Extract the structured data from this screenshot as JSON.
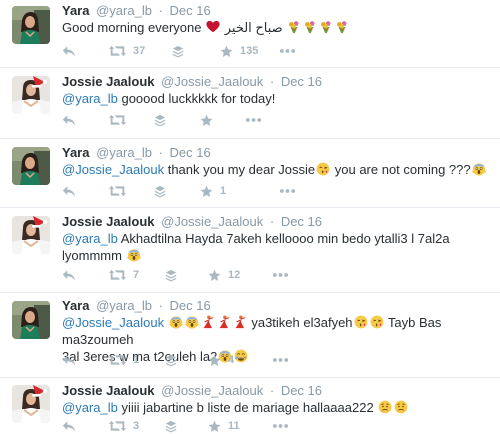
{
  "tweets": [
    {
      "fullname": "Yara",
      "username": "@yara_lb",
      "date": "Dec 16",
      "text_before": "Good morning everyone",
      "text_arabic": "صباح الخير",
      "mention": "",
      "text_after": "",
      "retweets": "37",
      "favorites": "135"
    },
    {
      "fullname": "Jossie Jaalouk",
      "username": "@Jossie_Jaalouk",
      "date": "Dec 16",
      "mention": "@yara_lb",
      "text": "gooood luckkkkk for today!",
      "retweets": "",
      "favorites": ""
    },
    {
      "fullname": "Yara",
      "username": "@yara_lb",
      "date": "Dec 16",
      "mention": "@Jossie_Jaalouk",
      "text_a": "thank you my dear Jossie",
      "text_b": "you are not coming ???",
      "retweets": "",
      "favorites": "1"
    },
    {
      "fullname": "Jossie Jaalouk",
      "username": "@Jossie_Jaalouk",
      "date": "Dec 16",
      "mention": "@yara_lb",
      "text": "Akhadtilna Hayda 7akeh kelloooo min bedo ytalli3 l 7al2a lyommmm",
      "retweets": "7",
      "favorites": "12"
    },
    {
      "fullname": "Yara",
      "username": "@yara_lb",
      "date": "Dec 16",
      "mention": "@Jossie_Jaalouk",
      "text_a": "ya3tikeh el3afyeh",
      "text_b": "Tayb Bas ma3zoumeh",
      "text_c": "3al 3eres w ma t2ouleh la2",
      "retweets": "1",
      "favorites": "4"
    },
    {
      "fullname": "Jossie Jaalouk",
      "username": "@Jossie_Jaalouk",
      "date": "Dec 16",
      "mention": "@yara_lb",
      "text": "yiiii jabartine b liste de mariage hallaaaa222",
      "retweets": "3",
      "favorites": "11"
    }
  ],
  "separator": "·",
  "icons": [
    "reply-icon",
    "retweet-icon",
    "save-icon",
    "favorite-icon",
    "more-icon"
  ],
  "colors": {
    "link": "#2b7bb9",
    "meta": "#8899a6",
    "action": "#aab8c2",
    "divider": "#e6ecf0"
  }
}
